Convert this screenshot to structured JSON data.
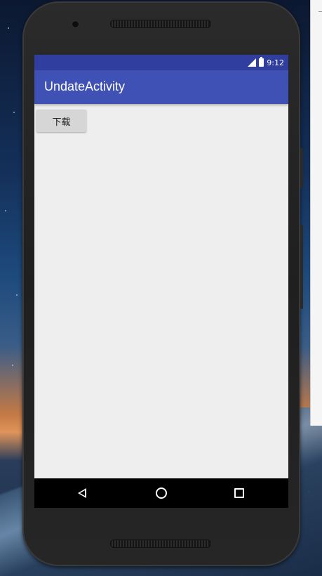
{
  "status_bar": {
    "time": "9:12",
    "signal_icon": "signal-icon",
    "battery_icon": "battery-charging-icon"
  },
  "app_bar": {
    "title": "UndateActivity"
  },
  "main": {
    "download_button_label": "下载"
  },
  "nav_bar": {
    "back_icon": "back-icon",
    "home_icon": "home-icon",
    "recents_icon": "recents-icon"
  },
  "colors": {
    "status_bar": "#303f9f",
    "app_bar": "#3f51b5",
    "content_background": "#eeeeee",
    "button": "#d6d6d6",
    "nav_bar": "#000000"
  }
}
